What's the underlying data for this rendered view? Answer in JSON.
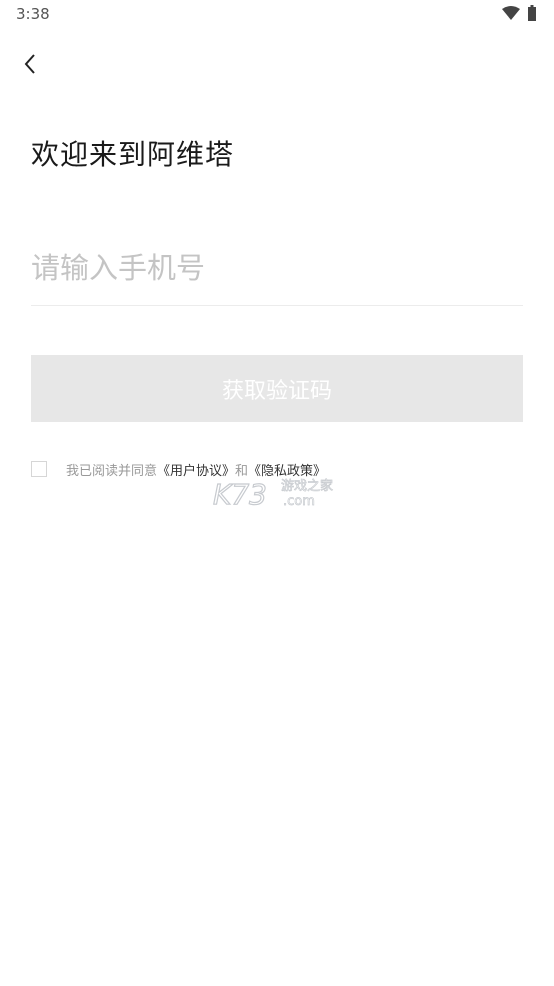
{
  "status_bar": {
    "time": "3:38",
    "wifi_icon": "wifi-icon",
    "battery_icon": "battery-icon"
  },
  "nav": {
    "back_icon": "chevron-left-icon"
  },
  "welcome_title": "欢迎来到阿维塔",
  "phone_input": {
    "placeholder": "请输入手机号",
    "value": ""
  },
  "get_code_button": "获取验证码",
  "agreement": {
    "checked": false,
    "prefix": "我已阅读并同意",
    "user_agreement": "《用户协议》",
    "conjunction": "和",
    "privacy_policy": "《隐私政策》"
  },
  "watermark": {
    "logo_text": "K73",
    "tagline": "游戏之家",
    "domain": ".com"
  },
  "colors": {
    "button_disabled_bg": "#e7e7e7",
    "placeholder": "#c4c4c4",
    "muted_text": "#999999"
  }
}
